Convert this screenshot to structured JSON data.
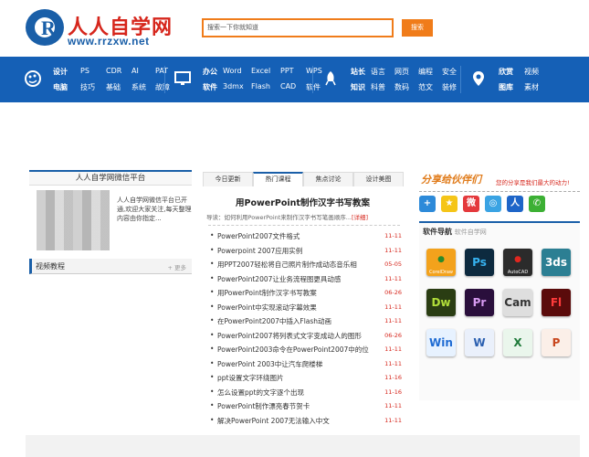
{
  "header": {
    "logo_title": "人人自学网",
    "logo_url": "www.rrzxw.net",
    "search_placeholder": "搜索一下你就知道",
    "search_button": "搜索"
  },
  "nav": {
    "groups": [
      {
        "icon": "design-icon",
        "rows": [
          [
            "设计",
            "PS",
            "CDR",
            "AI",
            "PAT"
          ],
          [
            "电脑",
            "技巧",
            "基础",
            "系统",
            "故障"
          ]
        ]
      },
      {
        "icon": "monitor-icon",
        "rows": [
          [
            "办公",
            "Word",
            "Excel",
            "PPT",
            "WPS"
          ],
          [
            "软件",
            "3dmx",
            "Flash",
            "CAD",
            "软件"
          ]
        ]
      },
      {
        "icon": "rocket-icon",
        "rows": [
          [
            "站长",
            "语言",
            "网页",
            "编程",
            "安全"
          ],
          [
            "知识",
            "科普",
            "数码",
            "范文",
            "装修"
          ]
        ]
      },
      {
        "icon": "location-icon",
        "rows": [
          [
            "欣赏",
            "视频"
          ],
          [
            "图库",
            "素材"
          ]
        ]
      }
    ]
  },
  "left": {
    "wx_title": "人人自学网微信平台",
    "wx_text": "人人自学网微信平台已开通,欢迎大家关注,每天整理内容由你指定...",
    "video_title": "视频教程",
    "video_more": "+ 更多"
  },
  "middle": {
    "tabs": [
      "今日更新",
      "热门课程",
      "焦点讨论",
      "设计美图"
    ],
    "active_tab": 1,
    "article_title": "用PowerPoint制作汉字书写教案",
    "article_intro": "导读：如何利用PowerPoint来制作汉字书写笔画顺序...",
    "article_more": "[详细]",
    "items": [
      {
        "text": "PowerPoint2007文件格式",
        "date": "11-11"
      },
      {
        "text": "Powerpoint 2007应用实例",
        "date": "11-11"
      },
      {
        "text": "用PPT2007轻松将自己照片制作成动态音乐相",
        "date": "05-05"
      },
      {
        "text": "PowerPoint2007让业务流程图更具动感",
        "date": "11-11"
      },
      {
        "text": "用PowerPoint制作汉字书写教案",
        "date": "06-26"
      },
      {
        "text": "PowerPoint中实现滚动字幕效果",
        "date": "11-11"
      },
      {
        "text": "在PowerPoint2007中插入Flash动画",
        "date": "11-11"
      },
      {
        "text": "PowerPoint2007将列表式文字变成动人的图形",
        "date": "06-26"
      },
      {
        "text": "PowerPoint2003命令在PowerPoint2007中的位",
        "date": "11-11"
      },
      {
        "text": "PowerPoint 2003中让汽车爬楼梯",
        "date": "11-11"
      },
      {
        "text": "ppt设置文字环绕图片",
        "date": "11-16"
      },
      {
        "text": "怎么设置ppt的文字逐个出现",
        "date": "11-16"
      },
      {
        "text": "PowerPoint制作漂亮春节贺卡",
        "date": "11-11"
      },
      {
        "text": "解决PowerPoint 2007无法输入中文",
        "date": "11-11"
      }
    ]
  },
  "right": {
    "share_title": "分享给伙伴们",
    "share_tag": "您的分享是我们最大的动力!",
    "share_icons": [
      "plus-share-icon",
      "qzone-icon",
      "weibo-icon",
      "tencent-weibo-icon",
      "renren-icon",
      "wechat-icon"
    ],
    "soft_title": "软件导航",
    "soft_subtitle": "软件自学网",
    "software": [
      {
        "name": "coreldraw-icon",
        "label": "CorelDraw",
        "bg": "#f3a21c",
        "fg": "#2a8a2a"
      },
      {
        "name": "photoshop-icon",
        "label": "Ps",
        "bg": "#0d2a3f",
        "fg": "#36b2f0"
      },
      {
        "name": "autocad-icon",
        "label": "AutoCAD",
        "bg": "#2b2b2b",
        "fg": "#e1271f"
      },
      {
        "name": "3dsmax-icon",
        "label": "3ds",
        "bg": "#2c7f93",
        "fg": "#ffffff"
      },
      {
        "name": "dreamweaver-icon",
        "label": "Dw",
        "bg": "#2a3d13",
        "fg": "#b2df3a"
      },
      {
        "name": "premiere-icon",
        "label": "Pr",
        "bg": "#2a0f3c",
        "fg": "#d69af0"
      },
      {
        "name": "video-camera-icon",
        "label": "Cam",
        "bg": "#dedede",
        "fg": "#333333"
      },
      {
        "name": "flash-icon",
        "label": "Fl",
        "bg": "#5a0b0b",
        "fg": "#ff3b3b"
      },
      {
        "name": "windows-icon",
        "label": "Win",
        "bg": "#e7f2ff",
        "fg": "#1e6bd3"
      },
      {
        "name": "word-icon",
        "label": "W",
        "bg": "#eaf0fb",
        "fg": "#2a5fb0"
      },
      {
        "name": "excel-icon",
        "label": "X",
        "bg": "#eaf6ec",
        "fg": "#1f7a3a"
      },
      {
        "name": "powerpoint-icon",
        "label": "P",
        "bg": "#fbefe8",
        "fg": "#c8461c"
      }
    ]
  }
}
